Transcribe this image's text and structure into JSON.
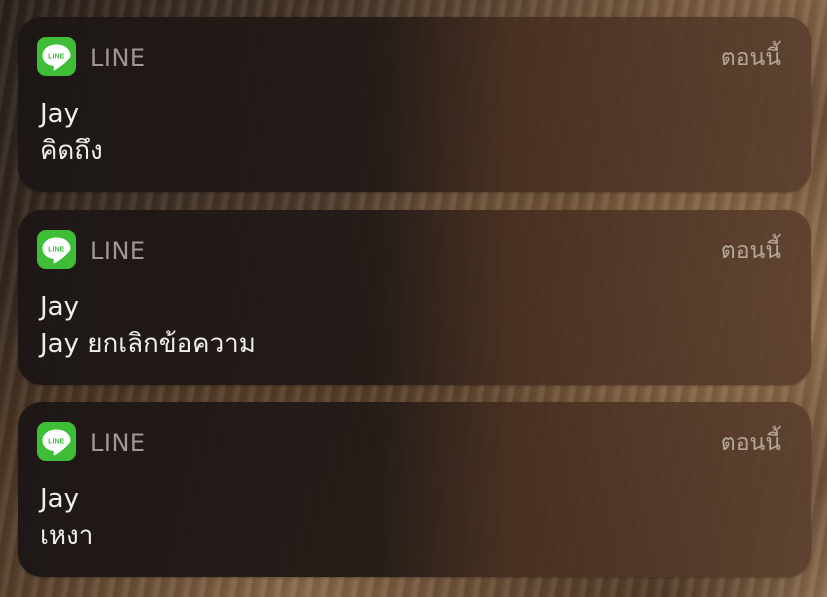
{
  "notifications": [
    {
      "app_icon": "line-app-icon",
      "app_icon_text": "LINE",
      "app_name": "LINE",
      "time": "ตอนนี้",
      "sender": "Jay",
      "message": "คิดถึง"
    },
    {
      "app_icon": "line-app-icon",
      "app_icon_text": "LINE",
      "app_name": "LINE",
      "time": "ตอนนี้",
      "sender": "Jay",
      "message": "Jay ยกเลิกข้อความ"
    },
    {
      "app_icon": "line-app-icon",
      "app_icon_text": "LINE",
      "app_name": "LINE",
      "time": "ตอนนี้",
      "sender": "Jay",
      "message": "เหงา"
    }
  ],
  "colors": {
    "line_green": "#3ebd36",
    "text_primary": "#f2eeec",
    "text_secondary": "#d2c8c4"
  }
}
